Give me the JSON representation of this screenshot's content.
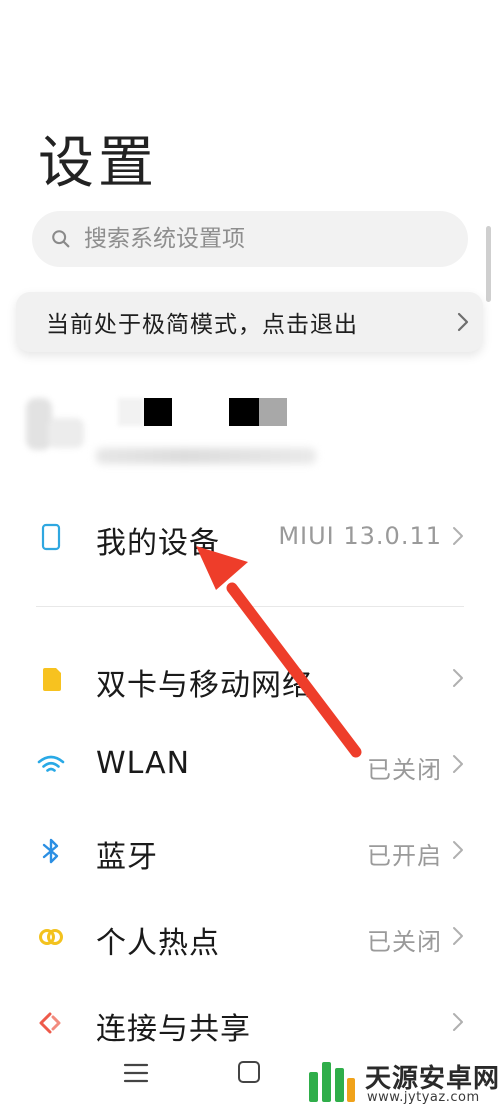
{
  "header": {
    "title": "设置"
  },
  "search": {
    "placeholder": "搜索系统设置项"
  },
  "banner": {
    "text": "当前处于极简模式，点击退出"
  },
  "account": {
    "name": "",
    "subtitle": ""
  },
  "device_row": {
    "label": "我的设备",
    "value": "MIUI 13.0.11"
  },
  "settings": [
    {
      "label": "双卡与移动网络",
      "value": "",
      "icon": "sim-card-icon",
      "color": "#f7c21f"
    },
    {
      "label": "WLAN",
      "value": "已关闭",
      "icon": "wifi-icon",
      "color": "#29a9e6"
    },
    {
      "label": "蓝牙",
      "value": "已开启",
      "icon": "bluetooth-icon",
      "color": "#2b8fe3"
    },
    {
      "label": "个人热点",
      "value": "已关闭",
      "icon": "hotspot-icon",
      "color": "#f3c21e"
    },
    {
      "label": "连接与共享",
      "value": "",
      "icon": "connection-sharing-icon",
      "color": "#ee5a4a"
    }
  ],
  "colors": {
    "accent_device": "#2fa7e0",
    "annotation_arrow": "#ee3d2a"
  },
  "watermark": {
    "title": "天源安卓网",
    "url": "www.jytyaz.com"
  }
}
